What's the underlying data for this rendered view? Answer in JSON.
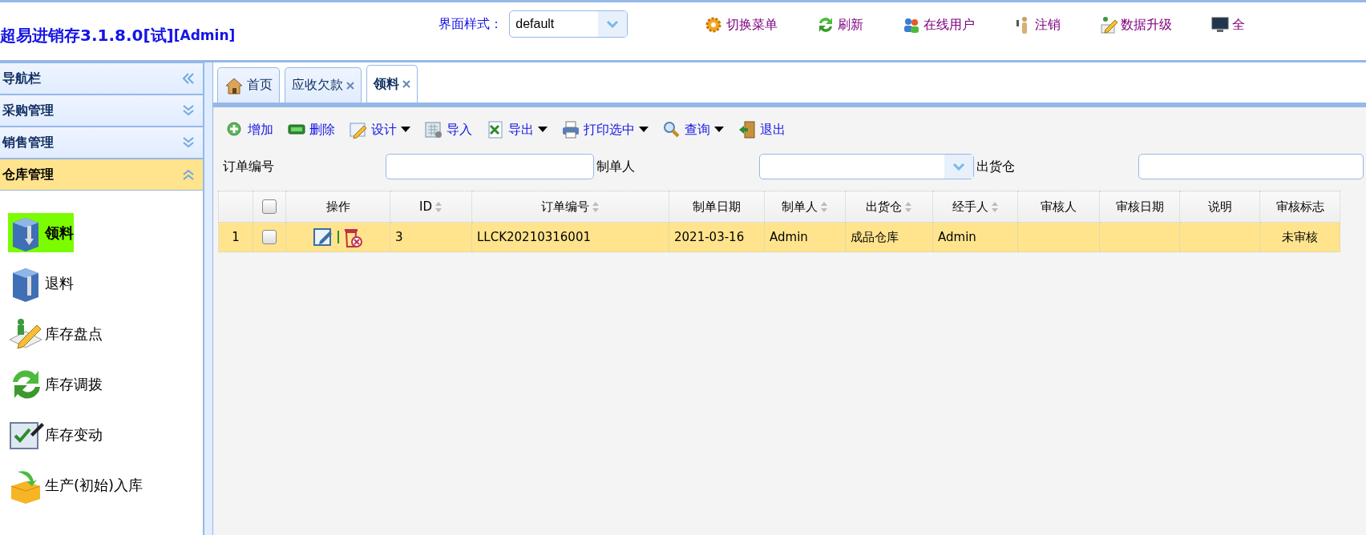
{
  "header": {
    "title": "超易进销存3.1.8.0[试]",
    "user": "[Admin]",
    "style_label": "界面样式：",
    "style_value": "default",
    "actions": [
      {
        "label": "切换菜单"
      },
      {
        "label": "刷新"
      },
      {
        "label": "在线用户"
      },
      {
        "label": "注销"
      },
      {
        "label": "数据升级"
      },
      {
        "label": "全"
      }
    ]
  },
  "sidebar": {
    "title": "导航栏",
    "groups": [
      {
        "label": "采购管理",
        "expanded": false
      },
      {
        "label": "销售管理",
        "expanded": false
      },
      {
        "label": "仓库管理",
        "expanded": true
      }
    ],
    "items": [
      {
        "label": "领料",
        "selected": true
      },
      {
        "label": "退料",
        "selected": false
      },
      {
        "label": "库存盘点",
        "selected": false
      },
      {
        "label": "库存调拨",
        "selected": false
      },
      {
        "label": "库存变动",
        "selected": false
      },
      {
        "label": "生产(初始)入库",
        "selected": false
      }
    ]
  },
  "tabs": [
    {
      "label": "首页",
      "selected": false,
      "closable": false
    },
    {
      "label": "应收欠款",
      "selected": false,
      "closable": true
    },
    {
      "label": "领料",
      "selected": true,
      "closable": true
    }
  ],
  "toolbar": [
    {
      "label": "增加",
      "dropdown": false
    },
    {
      "label": "删除",
      "dropdown": false
    },
    {
      "label": "设计",
      "dropdown": true
    },
    {
      "label": "导入",
      "dropdown": false
    },
    {
      "label": "导出",
      "dropdown": true
    },
    {
      "label": "打印选中",
      "dropdown": true
    },
    {
      "label": "查询",
      "dropdown": true
    },
    {
      "label": "退出",
      "dropdown": false
    }
  ],
  "filters": [
    {
      "label": "订单编号",
      "kind": "text"
    },
    {
      "label": "制单人",
      "kind": "combo"
    },
    {
      "label": "出货仓",
      "kind": "text"
    }
  ],
  "table": {
    "all_checked": false,
    "columns": [
      {
        "label": "操作",
        "sortable": false
      },
      {
        "label": "ID",
        "sortable": true
      },
      {
        "label": "订单编号",
        "sortable": true
      },
      {
        "label": "制单日期",
        "sortable": false
      },
      {
        "label": "制单人",
        "sortable": true
      },
      {
        "label": "出货仓",
        "sortable": true
      },
      {
        "label": "经手人",
        "sortable": true
      },
      {
        "label": "审核人",
        "sortable": false
      },
      {
        "label": "审核日期",
        "sortable": false
      },
      {
        "label": "说明",
        "sortable": false
      },
      {
        "label": "审核标志",
        "sortable": false
      }
    ],
    "rows": [
      {
        "number": "1",
        "selected": true,
        "checked": false,
        "cells": [
          "",
          "3",
          "LLCK20210316001",
          "2021-03-16",
          "Admin",
          "成品仓库",
          "Admin",
          "",
          "",
          "",
          "未审核"
        ]
      }
    ]
  }
}
